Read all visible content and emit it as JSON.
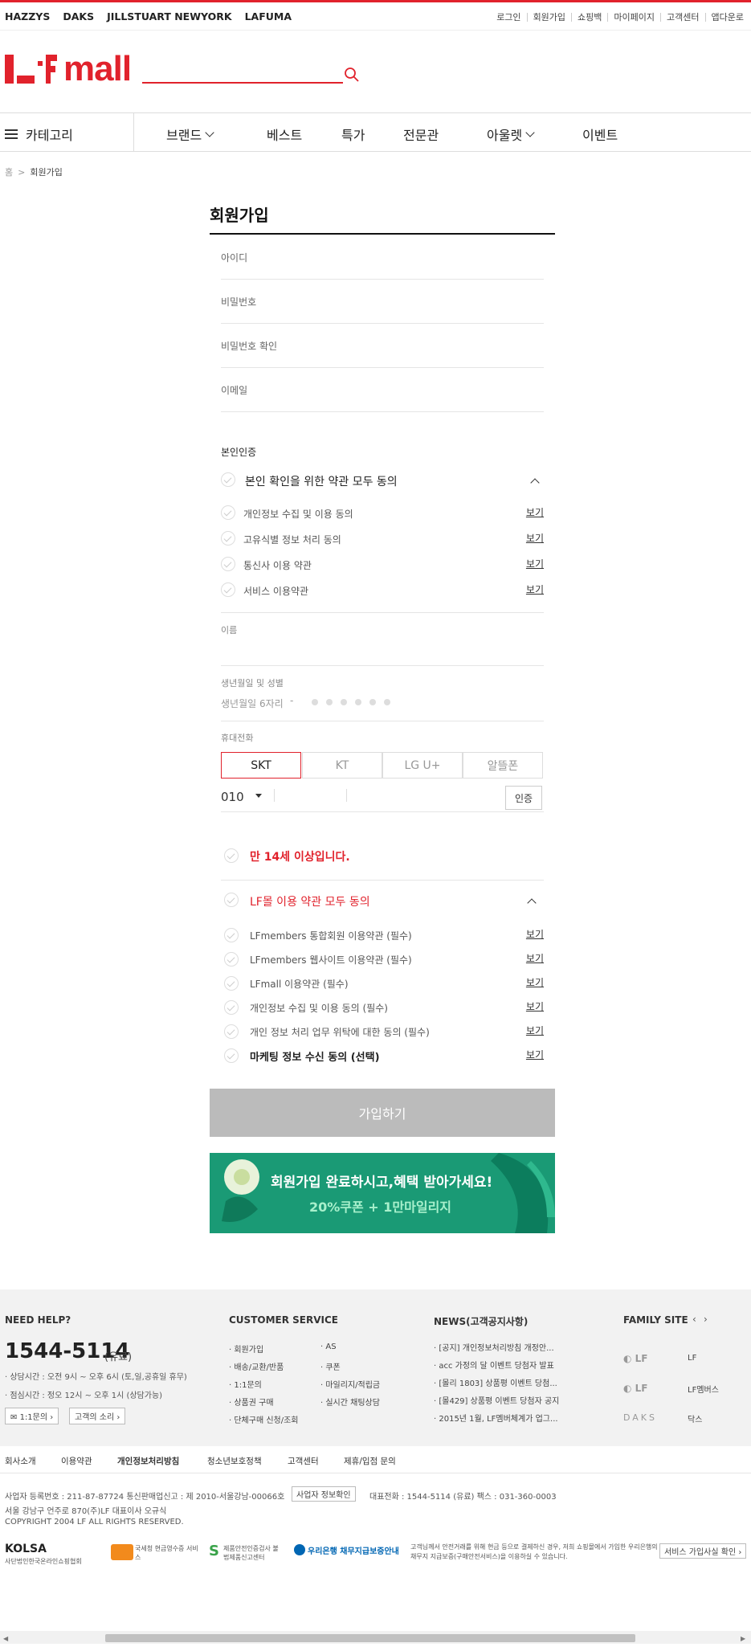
{
  "brands": [
    "HAZZYS",
    "DAKS",
    "JILLSTUART NEWYORK",
    "LAFUMA"
  ],
  "util": [
    "로그인",
    "회원가입",
    "쇼핑백",
    "마이페이지",
    "고객센터",
    "앱다운로"
  ],
  "logo_text": "mall",
  "nav": {
    "category": "카테고리",
    "items": [
      "브랜드",
      "베스트",
      "특가",
      "전문관",
      "아울렛",
      "이벤트"
    ]
  },
  "breadcrumb": {
    "home": "홈",
    "current": "회원가입"
  },
  "title": "회원가입",
  "fields": {
    "id": "아이디",
    "password": "비밀번호",
    "password_confirm": "비밀번호 확인",
    "email": "이메일"
  },
  "identity": {
    "heading": "본인인증",
    "all_agree": "본인 확인을 위한 약관 모두 동의",
    "terms": [
      "개인정보 수집 및 이용 동의",
      "고유식별 정보 처리 동의",
      "통신사 이용 약관",
      "서비스 이용약관"
    ],
    "view": "보기",
    "name_label": "이름",
    "birth_label": "생년월일 및 성별",
    "birth_placeholder": "생년월일 6자리",
    "phone_label": "휴대전화",
    "carriers": [
      "SKT",
      "KT",
      "LG U+",
      "알뜰폰"
    ],
    "phone_prefix": "010",
    "verify": "인증"
  },
  "agreements": {
    "age": "만 14세 이상입니다.",
    "all_lf": "LF몰 이용 약관 모두 동의",
    "terms": [
      "LFmembers 통합회원 이용약관 (필수)",
      "LFmembers 웹사이트 이용약관 (필수)",
      "LFmall 이용약관 (필수)",
      "개인정보 수집 및 이용 동의 (필수)",
      "개인 정보 처리 업무 위탁에 대한 동의 (필수)",
      "마케팅 정보 수신 동의 (선택)"
    ],
    "view": "보기"
  },
  "join_button": "가입하기",
  "banner": {
    "line1": "회원가입 완료하시고,혜택 받아가세요!",
    "line2": "20%쿠폰 + 1만마일리지"
  },
  "footer": {
    "need_help": "NEED HELP?",
    "phone": "1544-5114",
    "phone_suffix": "(유료)",
    "hours1": "상담시간 : 오전 9시 ~ 오후 6시 (토,일,공휴일 휴무)",
    "hours2": "점심시간 : 정오 12시 ~ 오후 1시 (상담가능)",
    "btn_qna": "1:1문의",
    "btn_voice": "고객의 소리",
    "cs_title": "CUSTOMER SERVICE",
    "cs_col1": [
      "회원가입",
      "배송/교환/반품",
      "1:1문의",
      "상품권 구매",
      "단체구매 신청/조회"
    ],
    "cs_col2": [
      "AS",
      "쿠폰",
      "마일리지/적립금",
      "실시간 채팅상담"
    ],
    "news_title": "NEWS(고객공지사항)",
    "news": [
      "[공지] 개인정보처리방침 개정안...",
      "acc 가정의 달 이벤트 당첨자 발표",
      "[몰리 1803] 상품평 이벤트 당첨...",
      "[몰429] 상품평 이벤트 당첨자 공지",
      "2015년 1월, LF멤버체계가 업그..."
    ],
    "family_title": "FAMILY SITE",
    "family": [
      "LF",
      "LF멤버스",
      "닥스"
    ],
    "bottom_links": [
      "회사소개",
      "이용약관",
      "개인정보처리방침",
      "청소년보호정책",
      "고객센터",
      "제휴/입점 문의"
    ],
    "biz1": "사업자 등록번호 : 211-87-87724 통신판매업신고 : 제 2010-서울강남-00066호",
    "biz_btn": "사업자 정보확인",
    "biz1b": "대표전화 : 1544-5114 (유료) 팩스 : 031-360-0003",
    "biz2": "서울 강남구 언주로 870(주)LF 대표이사 오규식",
    "copyright": "COPYRIGHT 2004 LF ALL RIGHTS RESERVED.",
    "cert1": "KOLSA",
    "cert1_sub": "사단법인한국온라인쇼핑협회",
    "cert2": "국세청 현금영수증 서비스",
    "cert3": "제품안전인증검사 불법제품신고센터",
    "cert4": "우리은행 채무지급보증안내",
    "cert4_desc": "고객님께서 안전거래를 위해 현금 등으로 결제하신 경우, 저희 쇼핑몰에서 가입한 우리은행의 채무지 지급보증(구매안전서비스)을 이용하실 수 있습니다.",
    "cert_btn": "서비스 가입사실 확인"
  }
}
